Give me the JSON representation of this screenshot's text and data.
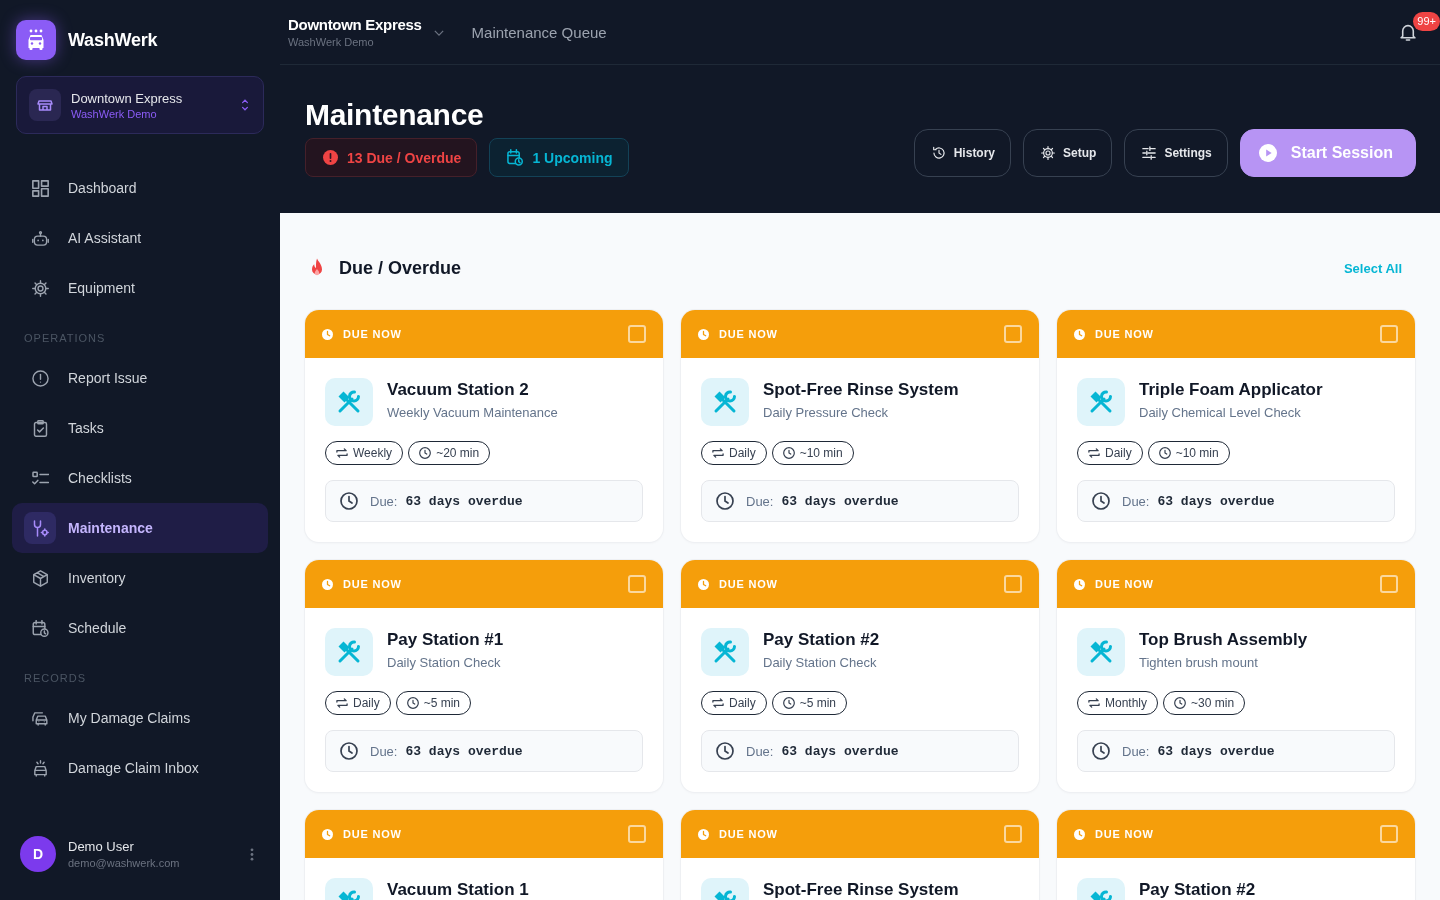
{
  "sidebar": {
    "brand": {
      "name": "WashWerk"
    },
    "location": {
      "name": "Downtown Express",
      "org": "WashWerk Demo"
    },
    "sections": [
      {
        "items": [
          {
            "kind": "dashboard",
            "label": "Dashboard",
            "selected": false
          },
          {
            "kind": "assistant",
            "label": "AI Assistant",
            "selected": false
          },
          {
            "kind": "equipment",
            "label": "Equipment",
            "selected": false
          }
        ]
      },
      {
        "title": "OPERATIONS",
        "items": [
          {
            "kind": "report",
            "label": "Report Issue",
            "selected": false
          },
          {
            "kind": "tasks",
            "label": "Tasks",
            "selected": false
          },
          {
            "kind": "checklists",
            "label": "Checklists",
            "selected": false
          },
          {
            "kind": "maintenance",
            "label": "Maintenance",
            "selected": true
          },
          {
            "kind": "inventory",
            "label": "Inventory",
            "selected": false
          },
          {
            "kind": "schedule",
            "label": "Schedule",
            "selected": false
          }
        ]
      },
      {
        "title": "RECORDS",
        "items": [
          {
            "kind": "claims",
            "label": "My Damage Claims",
            "selected": false
          },
          {
            "kind": "inbox",
            "label": "Damage Claim Inbox",
            "selected": false
          }
        ]
      }
    ],
    "user": {
      "initial": "D",
      "name": "Demo User",
      "email": "demo@washwerk.com"
    }
  },
  "topbar": {
    "location": {
      "name": "Downtown Express",
      "org": "WashWerk Demo"
    },
    "page": "Maintenance Queue",
    "notifications": {
      "badge": "99+"
    }
  },
  "header": {
    "title": "Maintenance",
    "chips": [
      {
        "kind": "due",
        "label": "13 Due / Overdue"
      },
      {
        "kind": "upcoming",
        "label": "1 Upcoming"
      }
    ],
    "actions": [
      {
        "kind": "history",
        "label": "History"
      },
      {
        "kind": "setup",
        "label": "Setup"
      },
      {
        "kind": "settings",
        "label": "Settings"
      },
      {
        "kind": "primary",
        "label": "Start Session"
      }
    ]
  },
  "section": {
    "title": "Due / Overdue",
    "select_all": "Select All",
    "cards": [
      {
        "status": "DUE NOW",
        "checked": false,
        "title": "Vacuum Station 2",
        "subtitle": "Weekly Vacuum Maintenance",
        "frequency": "Weekly",
        "duration": "~20 min",
        "due_label": "Due:",
        "due_value": "63 days overdue"
      },
      {
        "status": "DUE NOW",
        "checked": false,
        "title": "Spot-Free Rinse System",
        "subtitle": "Daily Pressure Check",
        "frequency": "Daily",
        "duration": "~10 min",
        "due_label": "Due:",
        "due_value": "63 days overdue"
      },
      {
        "status": "DUE NOW",
        "checked": false,
        "title": "Triple Foam Applicator",
        "subtitle": "Daily Chemical Level Check",
        "frequency": "Daily",
        "duration": "~10 min",
        "due_label": "Due:",
        "due_value": "63 days overdue"
      },
      {
        "status": "DUE NOW",
        "checked": false,
        "title": "Pay Station #1",
        "subtitle": "Daily Station Check",
        "frequency": "Daily",
        "duration": "~5 min",
        "due_label": "Due:",
        "due_value": "63 days overdue"
      },
      {
        "status": "DUE NOW",
        "checked": false,
        "title": "Pay Station #2",
        "subtitle": "Daily Station Check",
        "frequency": "Daily",
        "duration": "~5 min",
        "due_label": "Due:",
        "due_value": "63 days overdue"
      },
      {
        "status": "DUE NOW",
        "checked": false,
        "title": "Top Brush Assembly",
        "subtitle": "Tighten brush mount",
        "frequency": "Monthly",
        "duration": "~30 min",
        "due_label": "Due:",
        "due_value": "63 days overdue"
      },
      {
        "status": "DUE NOW",
        "checked": false,
        "title": "Vacuum Station 1"
      },
      {
        "status": "DUE NOW",
        "checked": false,
        "title": "Spot-Free Rinse System"
      },
      {
        "status": "DUE NOW",
        "checked": false,
        "title": "Pay Station #2"
      }
    ]
  }
}
